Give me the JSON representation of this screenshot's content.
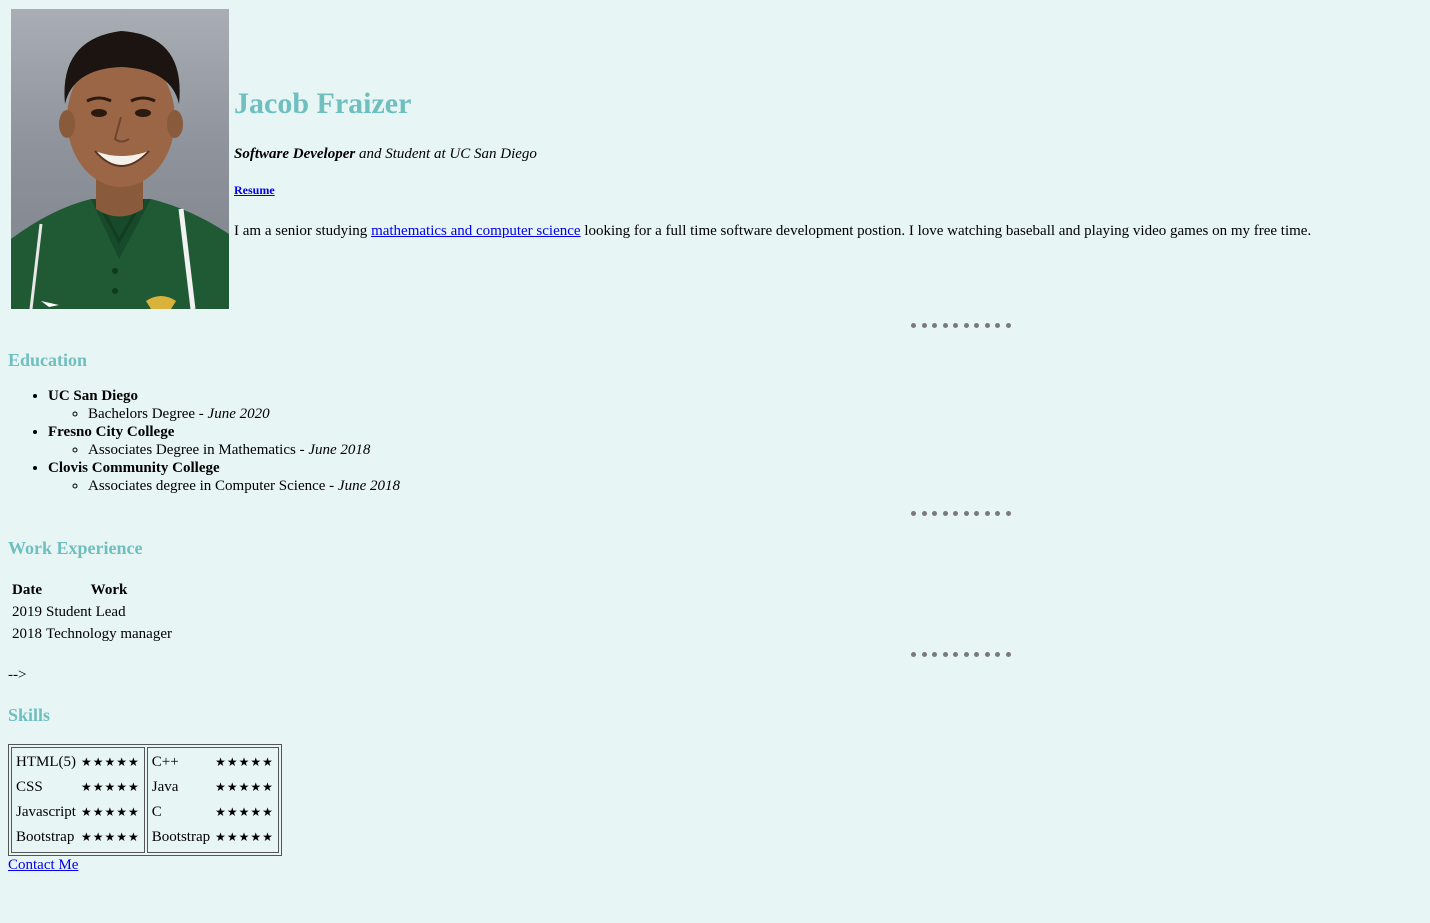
{
  "profile": {
    "name": "Jacob Fraizer",
    "tagline_role": "Software Developer",
    "tagline_rest": " and Student at UC San Diego",
    "resume_label": "Resume",
    "bio_before": "I am a senior studying ",
    "bio_link": "mathematics and computer science",
    "bio_after": " looking for a full time software development postion. I love watching baseball and playing video games on my free time."
  },
  "education": {
    "heading": "Education",
    "schools": [
      {
        "name": "UC San Diego",
        "degree": "Bachelors Degree - ",
        "date": "June 2020"
      },
      {
        "name": "Fresno City College",
        "degree": "Associates Degree in Mathematics - ",
        "date": "June 2018"
      },
      {
        "name": "Clovis Community College",
        "degree": "Associates degree in Computer Science - ",
        "date": "June 2018"
      }
    ]
  },
  "work": {
    "heading": "Work Experience",
    "col_date": "Date",
    "col_work": "Work",
    "rows": [
      {
        "date": "2019",
        "work": "Student Lead"
      },
      {
        "date": "2018",
        "work": "Technology manager"
      }
    ]
  },
  "stray_text": "-->",
  "skills": {
    "heading": "Skills",
    "left": [
      {
        "skill": "HTML(5)",
        "stars": "★★★★★"
      },
      {
        "skill": "CSS",
        "stars": "★★★★★"
      },
      {
        "skill": "Javascript",
        "stars": "★★★★★"
      },
      {
        "skill": "Bootstrap",
        "stars": "★★★★★"
      }
    ],
    "right": [
      {
        "skill": "C++",
        "stars": "★★★★★"
      },
      {
        "skill": "Java",
        "stars": "★★★★★"
      },
      {
        "skill": "C",
        "stars": "★★★★★"
      },
      {
        "skill": "Bootstrap",
        "stars": "★★★★★"
      }
    ]
  },
  "contact_label": "Contact Me",
  "colors": {
    "background": "#e8f5f5",
    "heading": "#6fbfbf",
    "link": "#0000ee",
    "dots": "#7a7a7a"
  }
}
